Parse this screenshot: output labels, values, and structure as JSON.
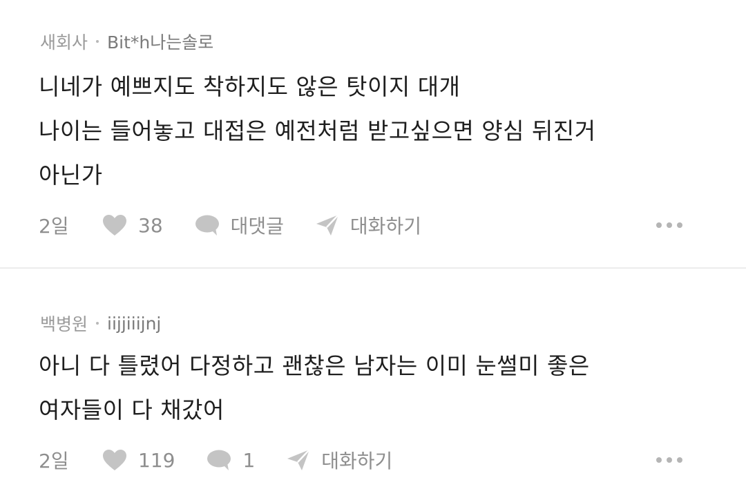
{
  "comments": [
    {
      "company": "새회사",
      "nickname": "Bit*h나는솔로",
      "lines": [
        "니네가 예쁘지도 착하지도 않은 탓이지 대개",
        "나이는 들어놓고 대접은 예전처럼 받고싶으면 양심 뒤진거",
        "아닌가"
      ],
      "time": "2일",
      "likes": "38",
      "reply_label": "대댓글",
      "chat_label": "대화하기"
    },
    {
      "company": "백병원",
      "nickname": "iijjiiijnj",
      "lines": [
        "아니 다 틀렸어 다정하고 괜찮은 남자는 이미 눈썰미 좋은",
        "여자들이 다 채갔어"
      ],
      "time": "2일",
      "likes": "119",
      "replies": "1",
      "chat_label": "대화하기"
    }
  ],
  "colors": {
    "text": "#1e1e1e",
    "meta": "#8e8e8e",
    "icon": "#c4c4c4",
    "divider": "#ececec"
  },
  "icons": {
    "like": "heart-icon",
    "reply": "speech-bubble-icon",
    "chat": "paper-plane-icon",
    "more": "more-dots-icon"
  }
}
